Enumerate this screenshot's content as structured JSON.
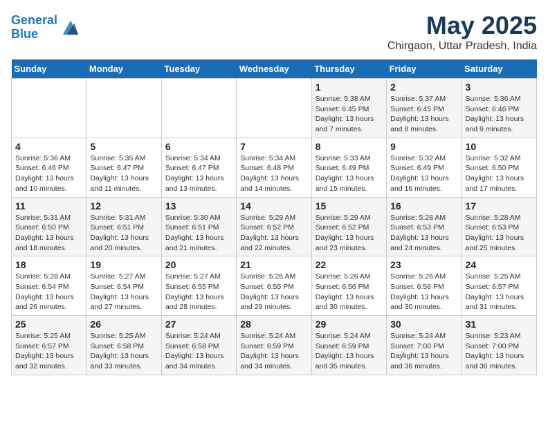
{
  "logo": {
    "line1": "General",
    "line2": "Blue"
  },
  "title": "May 2025",
  "subtitle": "Chirgaon, Uttar Pradesh, India",
  "days_header": [
    "Sunday",
    "Monday",
    "Tuesday",
    "Wednesday",
    "Thursday",
    "Friday",
    "Saturday"
  ],
  "weeks": [
    [
      {
        "num": "",
        "info": ""
      },
      {
        "num": "",
        "info": ""
      },
      {
        "num": "",
        "info": ""
      },
      {
        "num": "",
        "info": ""
      },
      {
        "num": "1",
        "info": "Sunrise: 5:38 AM\nSunset: 6:45 PM\nDaylight: 13 hours\nand 7 minutes."
      },
      {
        "num": "2",
        "info": "Sunrise: 5:37 AM\nSunset: 6:45 PM\nDaylight: 13 hours\nand 8 minutes."
      },
      {
        "num": "3",
        "info": "Sunrise: 5:36 AM\nSunset: 6:46 PM\nDaylight: 13 hours\nand 9 minutes."
      }
    ],
    [
      {
        "num": "4",
        "info": "Sunrise: 5:36 AM\nSunset: 6:46 PM\nDaylight: 13 hours\nand 10 minutes."
      },
      {
        "num": "5",
        "info": "Sunrise: 5:35 AM\nSunset: 6:47 PM\nDaylight: 13 hours\nand 11 minutes."
      },
      {
        "num": "6",
        "info": "Sunrise: 5:34 AM\nSunset: 6:47 PM\nDaylight: 13 hours\nand 13 minutes."
      },
      {
        "num": "7",
        "info": "Sunrise: 5:34 AM\nSunset: 6:48 PM\nDaylight: 13 hours\nand 14 minutes."
      },
      {
        "num": "8",
        "info": "Sunrise: 5:33 AM\nSunset: 6:49 PM\nDaylight: 13 hours\nand 15 minutes."
      },
      {
        "num": "9",
        "info": "Sunrise: 5:32 AM\nSunset: 6:49 PM\nDaylight: 13 hours\nand 16 minutes."
      },
      {
        "num": "10",
        "info": "Sunrise: 5:32 AM\nSunset: 6:50 PM\nDaylight: 13 hours\nand 17 minutes."
      }
    ],
    [
      {
        "num": "11",
        "info": "Sunrise: 5:31 AM\nSunset: 6:50 PM\nDaylight: 13 hours\nand 18 minutes."
      },
      {
        "num": "12",
        "info": "Sunrise: 5:31 AM\nSunset: 6:51 PM\nDaylight: 13 hours\nand 20 minutes."
      },
      {
        "num": "13",
        "info": "Sunrise: 5:30 AM\nSunset: 6:51 PM\nDaylight: 13 hours\nand 21 minutes."
      },
      {
        "num": "14",
        "info": "Sunrise: 5:29 AM\nSunset: 6:52 PM\nDaylight: 13 hours\nand 22 minutes."
      },
      {
        "num": "15",
        "info": "Sunrise: 5:29 AM\nSunset: 6:52 PM\nDaylight: 13 hours\nand 23 minutes."
      },
      {
        "num": "16",
        "info": "Sunrise: 5:28 AM\nSunset: 6:53 PM\nDaylight: 13 hours\nand 24 minutes."
      },
      {
        "num": "17",
        "info": "Sunrise: 5:28 AM\nSunset: 6:53 PM\nDaylight: 13 hours\nand 25 minutes."
      }
    ],
    [
      {
        "num": "18",
        "info": "Sunrise: 5:28 AM\nSunset: 6:54 PM\nDaylight: 13 hours\nand 26 minutes."
      },
      {
        "num": "19",
        "info": "Sunrise: 5:27 AM\nSunset: 6:54 PM\nDaylight: 13 hours\nand 27 minutes."
      },
      {
        "num": "20",
        "info": "Sunrise: 5:27 AM\nSunset: 6:55 PM\nDaylight: 13 hours\nand 28 minutes."
      },
      {
        "num": "21",
        "info": "Sunrise: 5:26 AM\nSunset: 6:55 PM\nDaylight: 13 hours\nand 29 minutes."
      },
      {
        "num": "22",
        "info": "Sunrise: 5:26 AM\nSunset: 6:56 PM\nDaylight: 13 hours\nand 30 minutes."
      },
      {
        "num": "23",
        "info": "Sunrise: 5:26 AM\nSunset: 6:56 PM\nDaylight: 13 hours\nand 30 minutes."
      },
      {
        "num": "24",
        "info": "Sunrise: 5:25 AM\nSunset: 6:57 PM\nDaylight: 13 hours\nand 31 minutes."
      }
    ],
    [
      {
        "num": "25",
        "info": "Sunrise: 5:25 AM\nSunset: 6:57 PM\nDaylight: 13 hours\nand 32 minutes."
      },
      {
        "num": "26",
        "info": "Sunrise: 5:25 AM\nSunset: 6:58 PM\nDaylight: 13 hours\nand 33 minutes."
      },
      {
        "num": "27",
        "info": "Sunrise: 5:24 AM\nSunset: 6:58 PM\nDaylight: 13 hours\nand 34 minutes."
      },
      {
        "num": "28",
        "info": "Sunrise: 5:24 AM\nSunset: 6:59 PM\nDaylight: 13 hours\nand 34 minutes."
      },
      {
        "num": "29",
        "info": "Sunrise: 5:24 AM\nSunset: 6:59 PM\nDaylight: 13 hours\nand 35 minutes."
      },
      {
        "num": "30",
        "info": "Sunrise: 5:24 AM\nSunset: 7:00 PM\nDaylight: 13 hours\nand 36 minutes."
      },
      {
        "num": "31",
        "info": "Sunrise: 5:23 AM\nSunset: 7:00 PM\nDaylight: 13 hours\nand 36 minutes."
      }
    ]
  ]
}
